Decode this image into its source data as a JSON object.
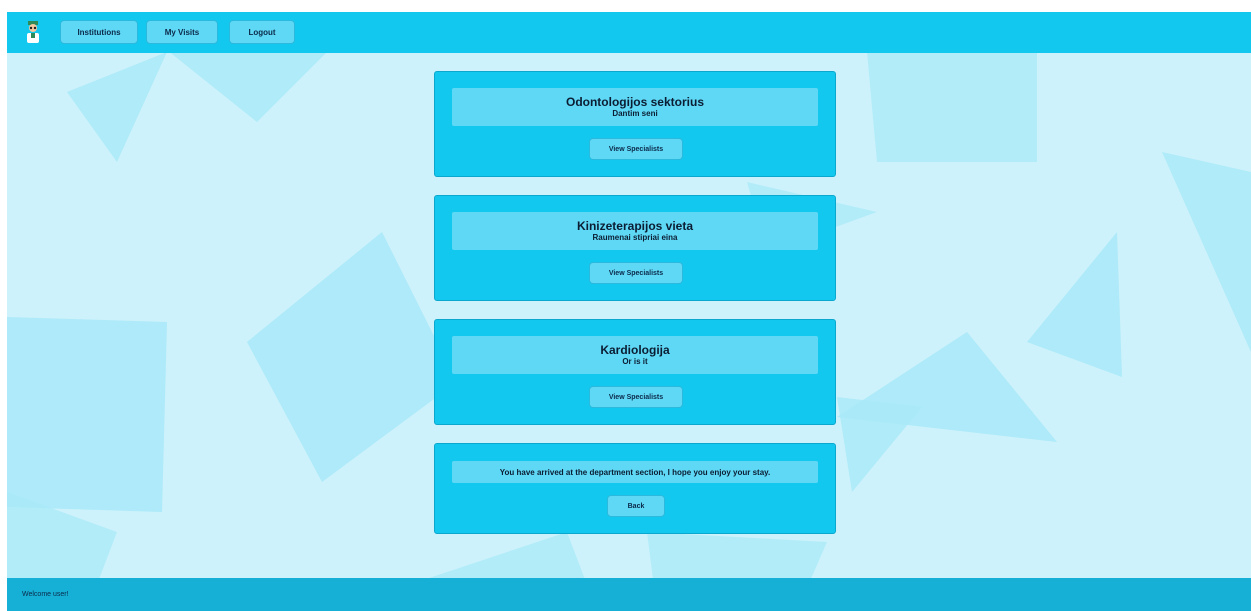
{
  "nav": {
    "logo_icon": "doctor-icon",
    "items": [
      "Institutions",
      "My Visits",
      "Logout"
    ]
  },
  "departments": [
    {
      "title": "Odontologijos sektorius",
      "subtitle": "Dantim seni",
      "button": "View Specialists"
    },
    {
      "title": "Kinizeterapijos vieta",
      "subtitle": "Raumenai stipriai eina",
      "button": "View Specialists"
    },
    {
      "title": "Kardiologija",
      "subtitle": "Or is it",
      "button": "View Specialists"
    }
  ],
  "info": {
    "message": "You have arrived at the department section, I hope you enjoy your stay.",
    "back_label": "Back"
  },
  "footer": {
    "text": "Welcome user!"
  },
  "colors": {
    "topbar": "#13c8ef",
    "card": "#13c8ef",
    "panel": "#5fd8f5",
    "footer": "#16b0d6",
    "background": "#cdf2fb"
  }
}
